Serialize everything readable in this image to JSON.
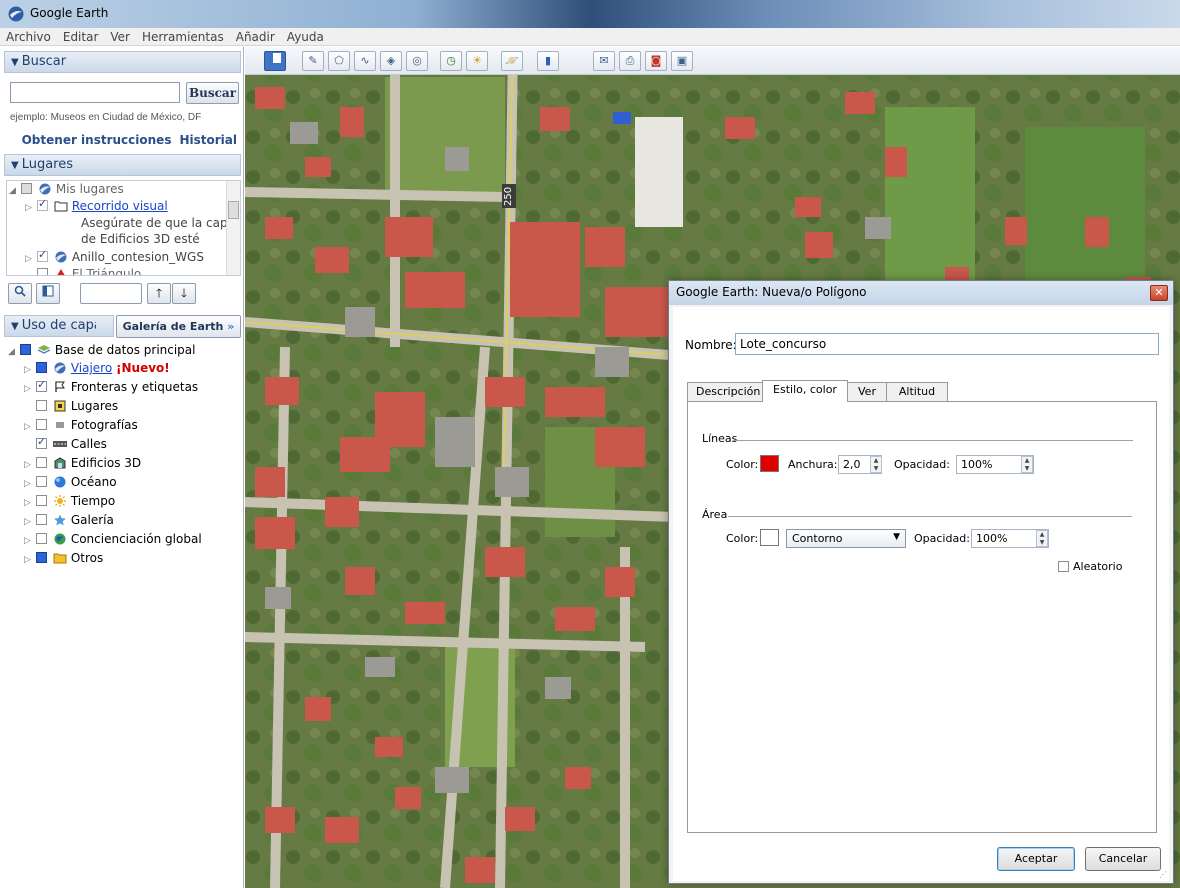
{
  "window": {
    "title": "Google Earth"
  },
  "menu": [
    "Archivo",
    "Editar",
    "Ver",
    "Herramientas",
    "Añadir",
    "Ayuda"
  ],
  "search_panel": {
    "header": "Buscar",
    "button": "Buscar",
    "input_value": "",
    "hint": "ejemplo: Museos en Ciudad de México, DF",
    "link_directions": "Obtener instrucciones",
    "link_history": "Historial"
  },
  "places_panel": {
    "header": "Lugares",
    "items": [
      {
        "label": "Mis lugares",
        "style": "gray"
      },
      {
        "label": "Recorrido visual",
        "style": "link"
      },
      {
        "label": "Asegúrate de que la capa",
        "style": "note"
      },
      {
        "label": "de Edificios 3D esté",
        "style": "note"
      },
      {
        "label": "Anillo_contesion_WGS",
        "style": "gray"
      },
      {
        "label": "El Triángulo",
        "style": "gray"
      }
    ]
  },
  "layers_panel": {
    "header": "Uso de capas",
    "gallery_button": "Galería de Earth",
    "root": "Base de datos principal",
    "items": [
      {
        "label": "Viajero",
        "badge": "¡Nuevo!",
        "checked": false,
        "link": true
      },
      {
        "label": "Fronteras y etiquetas",
        "checked": true
      },
      {
        "label": "Lugares",
        "checked": false
      },
      {
        "label": "Fotografías",
        "checked": false
      },
      {
        "label": "Calles",
        "checked": true
      },
      {
        "label": "Edificios 3D",
        "checked": false
      },
      {
        "label": "Océano",
        "checked": false
      },
      {
        "label": "Tiempo",
        "checked": false
      },
      {
        "label": "Galería",
        "checked": false
      },
      {
        "label": "Concienciación global",
        "checked": false
      },
      {
        "label": "Otros",
        "checked": false
      }
    ]
  },
  "map": {
    "road_label": "250"
  },
  "dialog": {
    "title": "Google Earth: Nueva/o Polígono",
    "name_label": "Nombre:",
    "name_value": "Lote_concurso",
    "tabs": [
      "Descripción",
      "Estilo, color",
      "Ver",
      "Altitud"
    ],
    "active_tab": "Estilo, color",
    "lines": {
      "section": "Líneas",
      "color_label": "Color:",
      "color": "#e00000",
      "width_label": "Anchura:",
      "width_value": "2,0",
      "opacity_label": "Opacidad:",
      "opacity_value": "100%"
    },
    "area": {
      "section": "Área",
      "color_label": "Color:",
      "color": "#ffffff",
      "mode_value": "Contorno",
      "opacity_label": "Opacidad:",
      "opacity_value": "100%",
      "random_label": "Aleatorio"
    },
    "ok": "Aceptar",
    "cancel": "Cancelar"
  }
}
